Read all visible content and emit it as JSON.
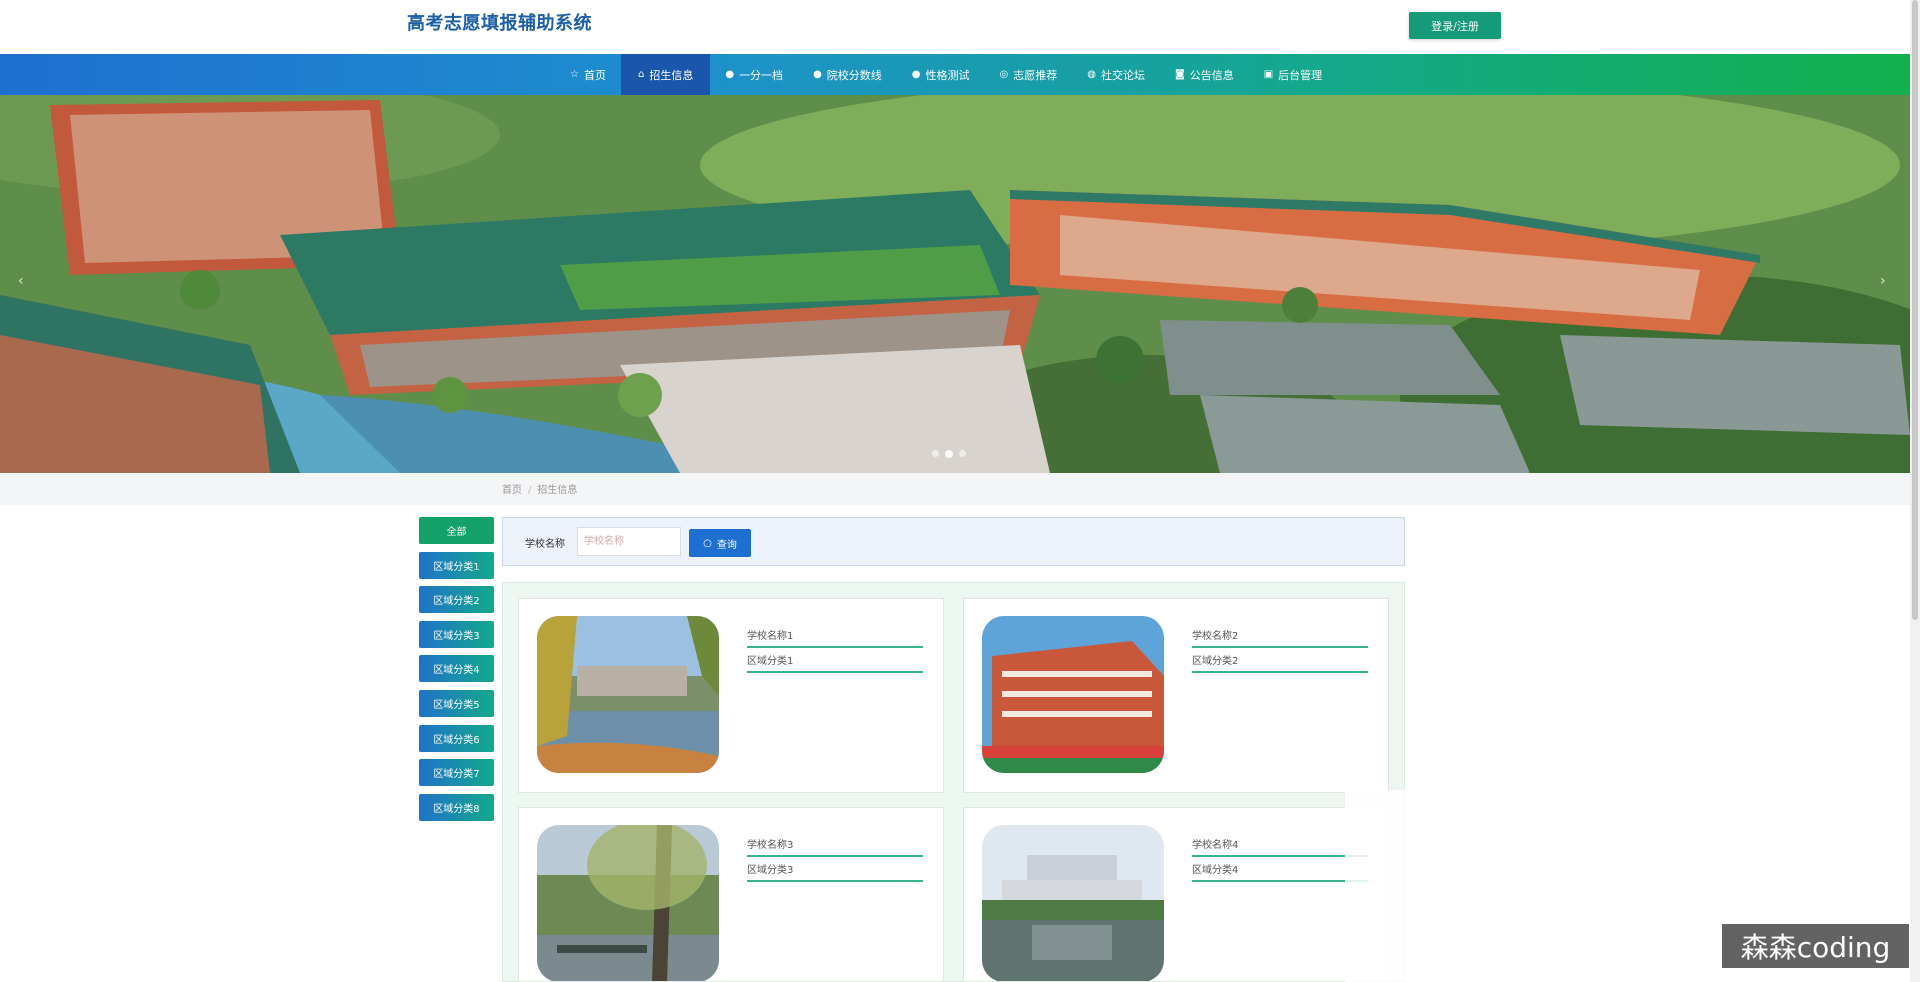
{
  "header": {
    "site_title": "高考志愿填报辅助系统",
    "login_label": "登录/注册"
  },
  "nav": {
    "items": [
      {
        "label": "首页",
        "icon": "star-icon"
      },
      {
        "label": "招生信息",
        "icon": "home-icon",
        "active": true
      },
      {
        "label": "一分一档",
        "icon": "info-circle-icon"
      },
      {
        "label": "院校分数线",
        "icon": "info-circle-icon"
      },
      {
        "label": "性格测试",
        "icon": "info-circle-icon"
      },
      {
        "label": "志愿推荐",
        "icon": "globe-icon"
      },
      {
        "label": "社交论坛",
        "icon": "compass-icon"
      },
      {
        "label": "公告信息",
        "icon": "camera-icon"
      },
      {
        "label": "后台管理",
        "icon": "calendar-icon"
      }
    ]
  },
  "carousel": {
    "slide_count": 3,
    "active_index": 1
  },
  "breadcrumb": {
    "home": "首页",
    "current": "招生信息"
  },
  "sidebar": {
    "items": [
      {
        "label": "全部",
        "active": true
      },
      {
        "label": "区域分类1"
      },
      {
        "label": "区域分类2"
      },
      {
        "label": "区域分类3"
      },
      {
        "label": "区域分类4"
      },
      {
        "label": "区域分类5"
      },
      {
        "label": "区域分类6"
      },
      {
        "label": "区域分类7"
      },
      {
        "label": "区域分类8"
      }
    ]
  },
  "search": {
    "label": "学校名称",
    "placeholder": "学校名称",
    "button_label": "查询"
  },
  "schools": [
    {
      "name": "学校名称1",
      "region": "区域分类1"
    },
    {
      "name": "学校名称2",
      "region": "区域分类2"
    },
    {
      "name": "学校名称3",
      "region": "区域分类3"
    },
    {
      "name": "学校名称4",
      "region": "区域分类4"
    }
  ],
  "watermark": "森森coding",
  "colors": {
    "brand_blue": "#1d5fa8",
    "nav_start": "#1f6fd0",
    "nav_end": "#12b04c",
    "accent_green": "#159a7a",
    "divider_green": "#38b48a"
  }
}
